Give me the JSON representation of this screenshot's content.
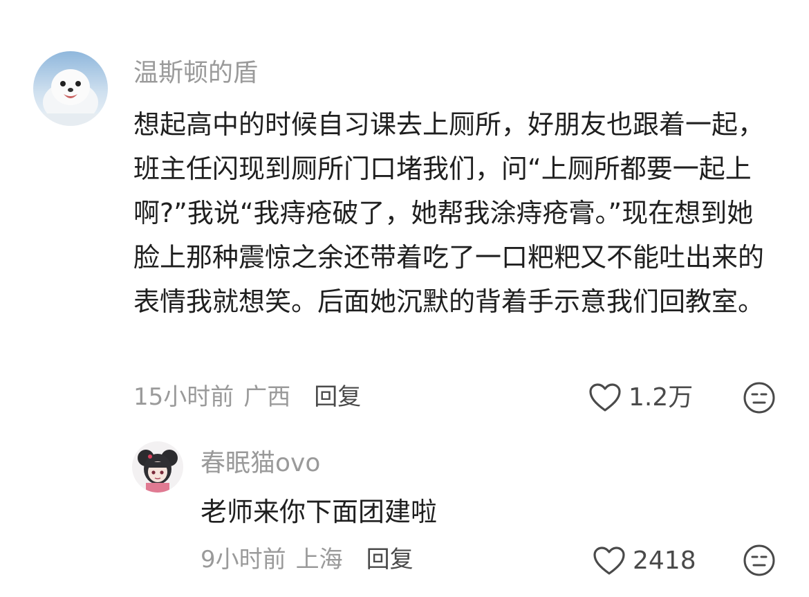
{
  "comments": [
    {
      "username": "温斯顿的盾",
      "avatar": "seal-avatar",
      "body": "想起高中的时候自习课去上厕所，好朋友也跟着一起，班主任闪现到厕所门口堵我们，问“上厕所都要一起上啊?”我说“我痔疮破了，她帮我涂痔疮膏。”现在想到她脸上那种震惊之余还带着吃了一口粑粑又不能吐出来的表情我就想笑。后面她沉默的背着手示意我们回教室。",
      "time": "15小时前",
      "location": "广西",
      "reply_label": "回复",
      "likes": "1.2万",
      "like_icon": "heart-outline-icon",
      "dislike_icon": "meh-face-icon"
    },
    {
      "username": "春眠猫ovo",
      "avatar": "anime-girl-avatar",
      "body": "老师来你下面团建啦",
      "time": "9小时前",
      "location": "上海",
      "reply_label": "回复",
      "likes": "2418",
      "like_icon": "heart-outline-icon",
      "dislike_icon": "meh-face-icon"
    }
  ],
  "colors": {
    "text": "#1f1f1f",
    "meta": "#9a9a9a",
    "action": "#4a4a4a",
    "background": "#ffffff"
  }
}
